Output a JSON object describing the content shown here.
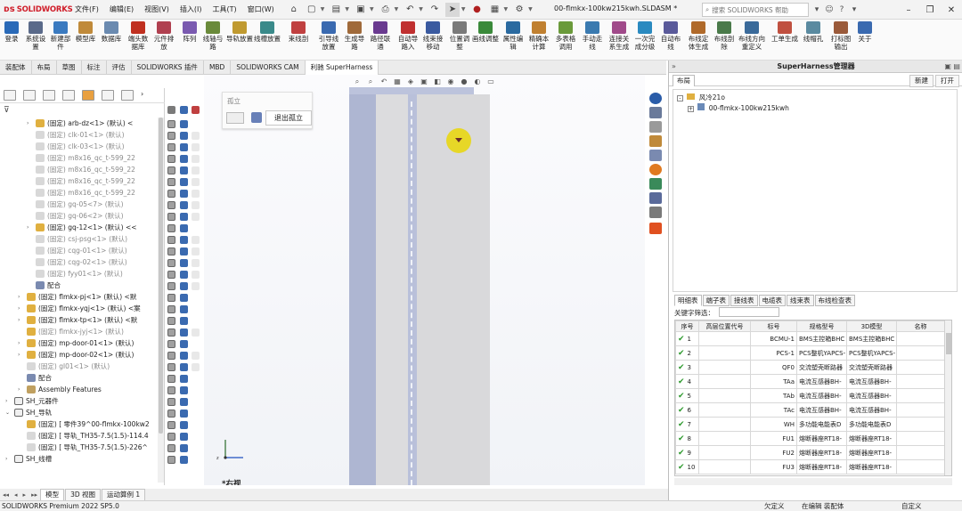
{
  "titlebar": {
    "brand": "SOLIDWORKS",
    "menus": [
      "文件(F)",
      "编辑(E)",
      "视图(V)",
      "插入(I)",
      "工具(T)",
      "窗口(W)"
    ],
    "document_title": "00-flmkx-100kw215kwh.SLDASM *",
    "search_placeholder": "搜索 SOLIDWORKS 帮助"
  },
  "ribbon": [
    "登录",
    "系统设置",
    "新建部件",
    "模型库",
    "数据库",
    "端头数据库",
    "元件排放",
    "阵列",
    "线轴与路",
    "导轨放置",
    "线槽放置",
    "束线剖",
    "引导线放置",
    "生成导路",
    "路径联通",
    "自动导路入",
    "线束接移动",
    "位置调整",
    "画线调整",
    "属性编辑",
    "精确本计算",
    "多表格调用",
    "手动走线",
    "连接关系生成",
    "一次完成分级",
    "自动布线",
    "布线定体生成",
    "布线剖除",
    "布线方向重定义",
    "工单生成",
    "线帽孔",
    "打标图输出",
    "关于"
  ],
  "cmd_tabs": [
    "装配体",
    "布局",
    "草图",
    "标注",
    "评估",
    "SOLIDWORKS 插件",
    "MBD",
    "SOLIDWORKS CAM",
    "利驰 SuperHarness"
  ],
  "tree": [
    {
      "label": "(固定) arb-dz<1> (默认) <",
      "gray": false
    },
    {
      "label": "(固定) clk-01<1> (默认)",
      "gray": true
    },
    {
      "label": "(固定) clk-03<1> (默认)",
      "gray": true
    },
    {
      "label": "(固定) m8x16_qc_t-599_22",
      "gray": true
    },
    {
      "label": "(固定) m8x16_qc_t-599_22",
      "gray": true
    },
    {
      "label": "(固定) m8x16_qc_t-599_22",
      "gray": true
    },
    {
      "label": "(固定) m8x16_qc_t-599_22",
      "gray": true
    },
    {
      "label": "(固定) gq-05<7> (默认)",
      "gray": true
    },
    {
      "label": "(固定) gq-06<2> (默认)",
      "gray": true
    },
    {
      "label": "(固定) gq-12<1> (默认) <<",
      "gray": false
    },
    {
      "label": "(固定) csj-psg<1> (默认)",
      "gray": true
    },
    {
      "label": "(固定) cqg-01<1> (默认)",
      "gray": true
    },
    {
      "label": "(固定) cqg-02<1> (默认)",
      "gray": true
    },
    {
      "label": "(固定) fyy01<1> (默认)",
      "gray": true
    },
    {
      "label": "配合",
      "gray": false
    },
    {
      "label": "(固定) flmkx-pj<1> (默认) <默",
      "gray": false
    },
    {
      "label": "(固定) flmkx-yqj<1> (默认) <案",
      "gray": false
    },
    {
      "label": "(固定) flmkx-tp<1> (默认) <默",
      "gray": false
    },
    {
      "label": "(固定) flmkx-jyj<1> (默认)",
      "gray": true
    },
    {
      "label": "(固定) mp-door-01<1> (默认)",
      "gray": false
    },
    {
      "label": "(固定) mp-door-02<1> (默认)",
      "gray": false
    },
    {
      "label": "(固定) gl01<1> (默认)",
      "gray": true
    },
    {
      "label": "配合",
      "gray": false
    },
    {
      "label": "Assembly Features",
      "gray": false
    },
    {
      "label": "SH_元器件",
      "gray": false
    },
    {
      "label": "SH_导轨",
      "gray": false
    },
    {
      "label": "(固定) [ 零件39^00-flmkx-100kw2",
      "gray": false
    },
    {
      "label": "(固定) [ 导轨_TH35-7.5(1.5)-114.4",
      "gray": false
    },
    {
      "label": "(固定) [ 导轨_TH35-7.5(1.5)-226^",
      "gray": false
    },
    {
      "label": "SH_线槽",
      "gray": false
    }
  ],
  "isolate": {
    "title": "孤立",
    "exit_label": "退出孤立"
  },
  "view_name": "*右视",
  "panel": {
    "title": "SuperHarness管理器",
    "tab_layout": "布局",
    "btn_new": "新建",
    "btn_open": "打开",
    "tree_root": "风冷21o",
    "tree_child": "00-flmkx-100kw215kwh",
    "list_tabs": [
      "明细表",
      "端子表",
      "接线表",
      "电缆表",
      "线束表",
      "布线检查表"
    ],
    "filter_label": "关键字筛选：",
    "columns": [
      "序号",
      "高层位置代号",
      "标号",
      "规格型号",
      "3D模型",
      "名称"
    ],
    "rows": [
      {
        "no": "1",
        "tag": "BCMU-1",
        "spec": "BMS主控箱BHC",
        "model": "BMS主控箱BHC"
      },
      {
        "no": "2",
        "tag": "PCS-1",
        "spec": "PCS整机YAPCS-",
        "model": "PCS整机YAPCS-"
      },
      {
        "no": "3",
        "tag": "QF0",
        "spec": "交流塑壳断路器",
        "model": "交流塑壳断路器"
      },
      {
        "no": "4",
        "tag": "TAa",
        "spec": "电流互感器BH-",
        "model": "电流互感器BH-"
      },
      {
        "no": "5",
        "tag": "TAb",
        "spec": "电流互感器BH-",
        "model": "电流互感器BH-"
      },
      {
        "no": "6",
        "tag": "TAc",
        "spec": "电流互感器BH-",
        "model": "电流互感器BH-"
      },
      {
        "no": "7",
        "tag": "WH",
        "spec": "多功能电能表D",
        "model": "多功能电能表D"
      },
      {
        "no": "8",
        "tag": "FU1",
        "spec": "熔断器座RT18-",
        "model": "熔断器座RT18-"
      },
      {
        "no": "9",
        "tag": "FU2",
        "spec": "熔断器座RT18-",
        "model": "熔断器座RT18-"
      },
      {
        "no": "10",
        "tag": "FU3",
        "spec": "熔断器座RT18-",
        "model": "熔断器座RT18-"
      }
    ]
  },
  "bottom_tabs": [
    "模型",
    "3D 视图",
    "运动算例 1"
  ],
  "status": {
    "version": "SOLIDWORKS Premium 2022 SP5.0",
    "defined": "欠定义",
    "editing": "在编辑 装配体",
    "custom": "自定义"
  },
  "colors": {
    "brand_red": "#d01e2a",
    "check_green": "#2e9a2e",
    "highlight_yellow": "#e8d71e",
    "rail_blue": "#aeb6d2"
  }
}
